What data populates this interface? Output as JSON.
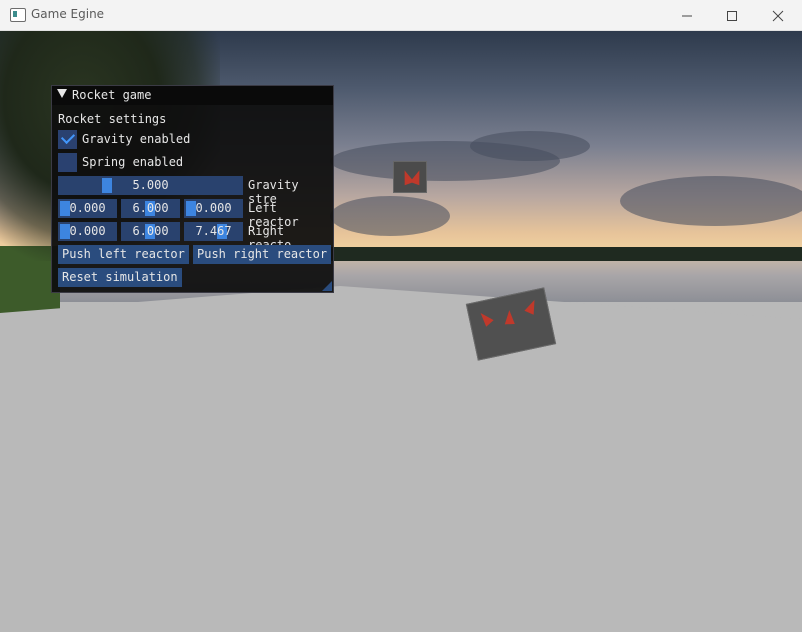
{
  "window": {
    "title": "Game Egine",
    "controls": {
      "minimize": "minimize-icon",
      "maximize": "maximize-icon",
      "close": "close-icon"
    }
  },
  "panel": {
    "title": "Rocket game",
    "section_label": "Rocket settings",
    "gravity_checkbox": {
      "label": "Gravity enabled",
      "checked": true
    },
    "spring_checkbox": {
      "label": "Spring enabled",
      "checked": false
    },
    "gravity_strength": {
      "value": "5.000",
      "label": "Gravity stre",
      "fraction": 0.3
    },
    "left_reactor": {
      "values": [
        "0.000",
        "6.000",
        "0.000"
      ],
      "label": "Left reactor"
    },
    "right_reactor": {
      "values": [
        "0.000",
        "6.000",
        "7.467"
      ],
      "label": "Right reacto"
    },
    "push_left_label": "Push left reactor",
    "push_right_label": "Push right reactor",
    "reset_label": "Reset simulation"
  },
  "colors": {
    "panel_bg": "#0f0f0f",
    "frame_bg": "#29426e",
    "slider_grab": "#3d85e0",
    "button": "#2a4c7e",
    "checkmark": "#4296fa",
    "floor": "#b9b9b9"
  }
}
